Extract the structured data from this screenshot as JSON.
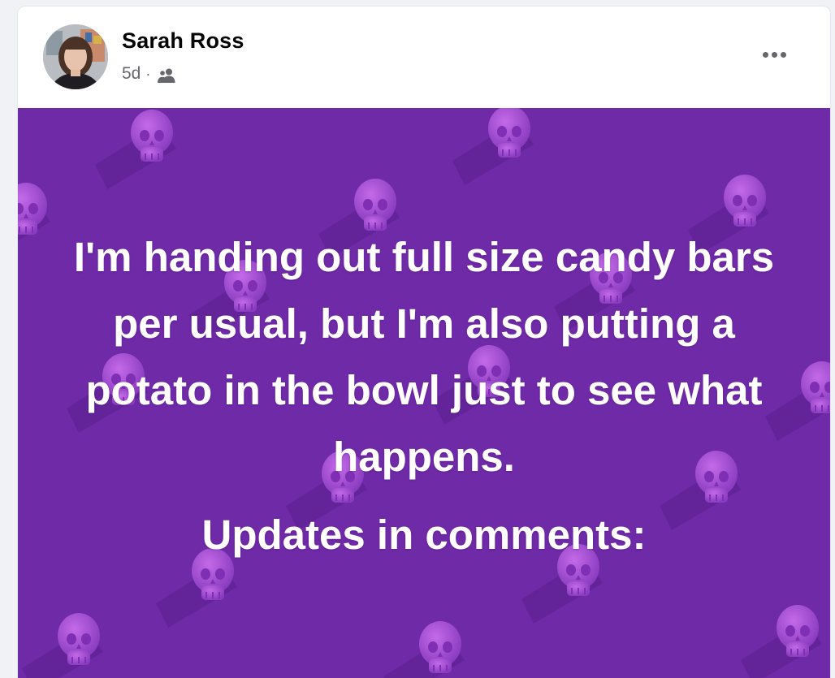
{
  "post": {
    "author": "Sarah Ross",
    "time": "5d",
    "separator": "·",
    "audience_icon": "friends-icon",
    "more_icon": "more-options-icon",
    "background_color": "#6f2aa7",
    "text_color": "#ffffff",
    "body_text": "I'm handing out full size candy bars per usual, but I'm also putting a potato in the bowl just to see what happens.",
    "updates_text": "Updates in comments:"
  }
}
